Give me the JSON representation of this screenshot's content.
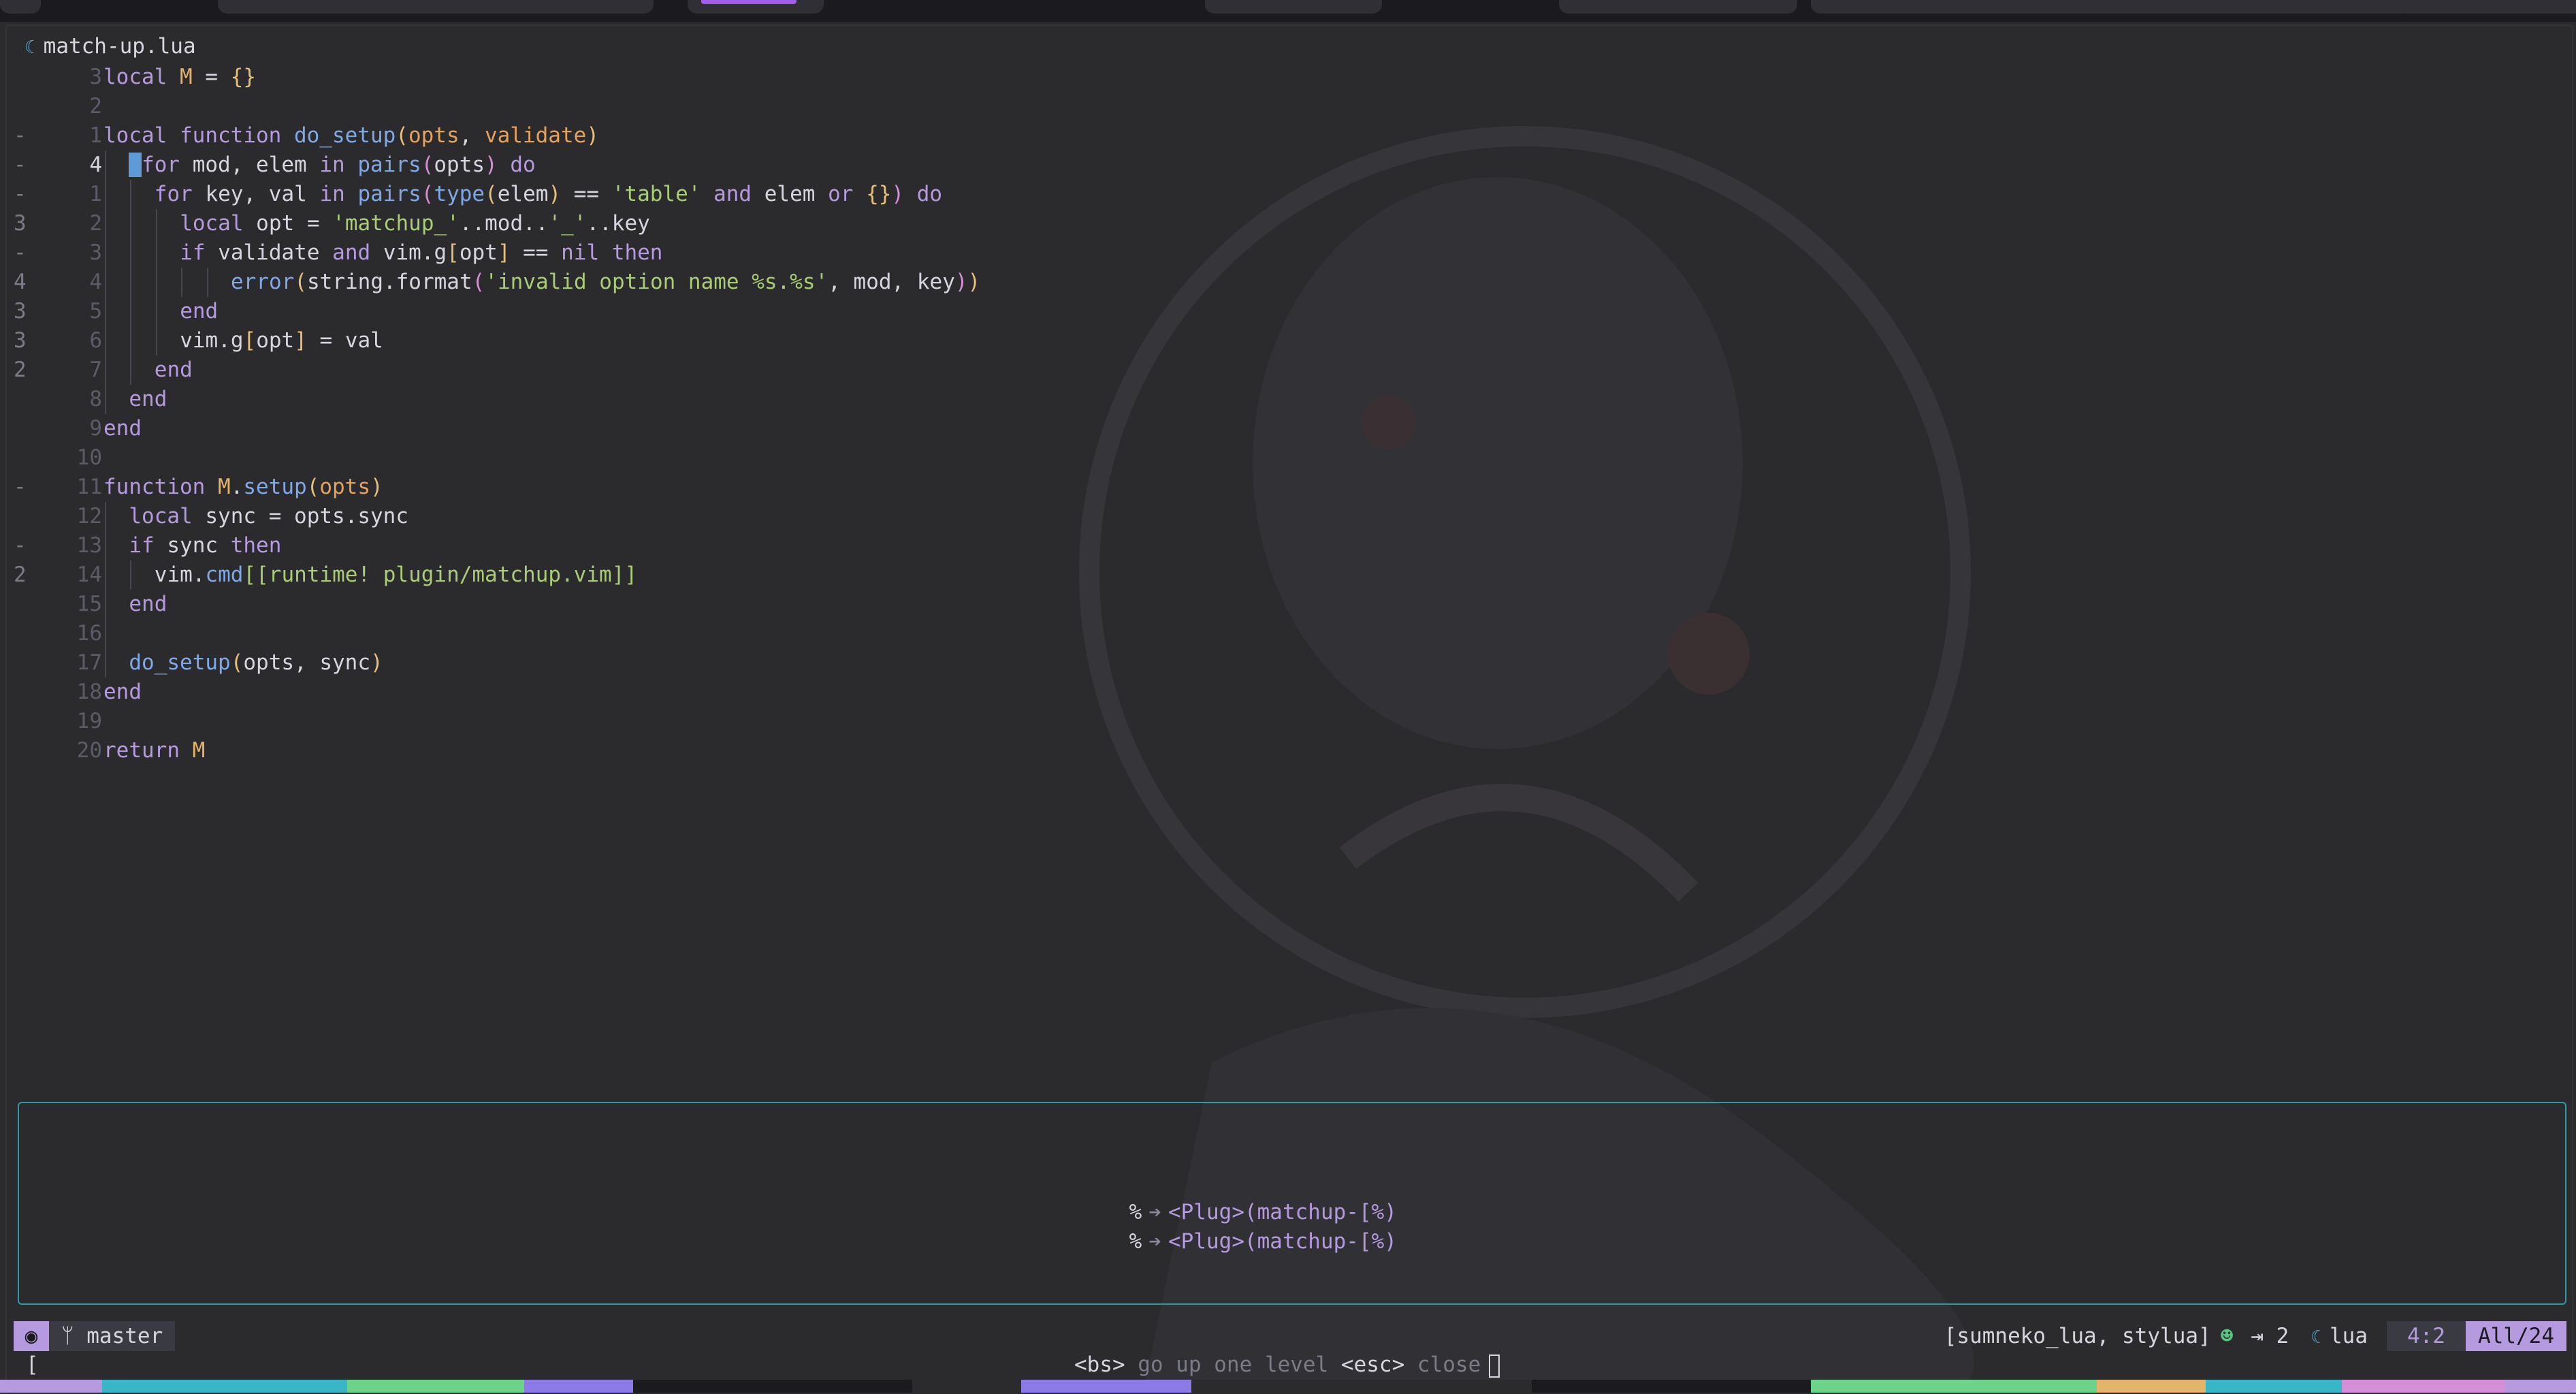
{
  "file_tab": {
    "name": "match-up.lua"
  },
  "code_lines": [
    {
      "rel": "",
      "num": "3",
      "cur": false,
      "indent": 0,
      "tokens": [
        [
          "kw",
          "local"
        ],
        [
          "op",
          " "
        ],
        [
          "var",
          "M"
        ],
        [
          "op",
          " = "
        ],
        [
          "br",
          "{}"
        ]
      ]
    },
    {
      "rel": "",
      "num": "2",
      "cur": false,
      "indent": 0,
      "tokens": []
    },
    {
      "rel": "-",
      "num": "1",
      "cur": false,
      "indent": 0,
      "tokens": [
        [
          "kw",
          "local"
        ],
        [
          "op",
          " "
        ],
        [
          "kw",
          "function"
        ],
        [
          "op",
          " "
        ],
        [
          "fn",
          "do_setup"
        ],
        [
          "br",
          "("
        ],
        [
          "pa",
          "opts"
        ],
        [
          "op",
          ", "
        ],
        [
          "pa",
          "validate"
        ],
        [
          "br",
          ")"
        ]
      ]
    },
    {
      "rel": "-",
      "num": "4",
      "cur": true,
      "indent": 1,
      "tokens": [
        [
          "cursor",
          " "
        ],
        [
          "kw",
          "for"
        ],
        [
          "op",
          " mod, elem "
        ],
        [
          "kw",
          "in"
        ],
        [
          "op",
          " "
        ],
        [
          "fn",
          "pairs"
        ],
        [
          "br2",
          "("
        ],
        [
          "id",
          "opts"
        ],
        [
          "br2",
          ")"
        ],
        [
          "op",
          " "
        ],
        [
          "kw",
          "do"
        ]
      ]
    },
    {
      "rel": "-",
      "num": "1",
      "cur": false,
      "indent": 2,
      "tokens": [
        [
          "kw",
          "for"
        ],
        [
          "op",
          " key, val "
        ],
        [
          "kw",
          "in"
        ],
        [
          "op",
          " "
        ],
        [
          "fn",
          "pairs"
        ],
        [
          "br2",
          "("
        ],
        [
          "fn",
          "type"
        ],
        [
          "br",
          "("
        ],
        [
          "id",
          "elem"
        ],
        [
          "br",
          ")"
        ],
        [
          "op",
          " == "
        ],
        [
          "str",
          "'table'"
        ],
        [
          "op",
          " "
        ],
        [
          "kw",
          "and"
        ],
        [
          "op",
          " elem "
        ],
        [
          "kw",
          "or"
        ],
        [
          "op",
          " "
        ],
        [
          "br",
          "{}"
        ],
        [
          "br2",
          ")"
        ],
        [
          "op",
          " "
        ],
        [
          "kw",
          "do"
        ]
      ]
    },
    {
      "rel": "3",
      "num": "2",
      "cur": false,
      "indent": 3,
      "tokens": [
        [
          "kw",
          "local"
        ],
        [
          "op",
          " opt = "
        ],
        [
          "str",
          "'matchup_'"
        ],
        [
          "op",
          "..mod.."
        ],
        [
          "str",
          "'_'"
        ],
        [
          "op",
          "..key"
        ]
      ]
    },
    {
      "rel": "-",
      "num": "3",
      "cur": false,
      "indent": 3,
      "tokens": [
        [
          "kw",
          "if"
        ],
        [
          "op",
          " validate "
        ],
        [
          "kw",
          "and"
        ],
        [
          "op",
          " vim.g"
        ],
        [
          "br",
          "["
        ],
        [
          "id",
          "opt"
        ],
        [
          "br",
          "]"
        ],
        [
          "op",
          " == "
        ],
        [
          "kw",
          "nil"
        ],
        [
          "op",
          " "
        ],
        [
          "kw",
          "then"
        ]
      ]
    },
    {
      "rel": "4",
      "num": "4",
      "cur": false,
      "indent": 5,
      "tokens": [
        [
          "fn",
          "error"
        ],
        [
          "br",
          "("
        ],
        [
          "id",
          "string.format"
        ],
        [
          "br2",
          "("
        ],
        [
          "str",
          "'invalid option name %s.%s'"
        ],
        [
          "op",
          ", mod, key"
        ],
        [
          "br2",
          ")"
        ],
        [
          "br",
          ")"
        ]
      ]
    },
    {
      "rel": "3",
      "num": "5",
      "cur": false,
      "indent": 3,
      "tokens": [
        [
          "kw",
          "end"
        ]
      ]
    },
    {
      "rel": "3",
      "num": "6",
      "cur": false,
      "indent": 3,
      "tokens": [
        [
          "id",
          "vim.g"
        ],
        [
          "br",
          "["
        ],
        [
          "id",
          "opt"
        ],
        [
          "br",
          "]"
        ],
        [
          "op",
          " = val"
        ]
      ]
    },
    {
      "rel": "2",
      "num": "7",
      "cur": false,
      "indent": 2,
      "tokens": [
        [
          "kw",
          "end"
        ]
      ]
    },
    {
      "rel": "",
      "num": "8",
      "cur": false,
      "indent": 1,
      "tokens": [
        [
          "kw",
          "end"
        ]
      ]
    },
    {
      "rel": "",
      "num": "9",
      "cur": false,
      "indent": 0,
      "tokens": [
        [
          "kw",
          "end"
        ]
      ]
    },
    {
      "rel": "",
      "num": "10",
      "cur": false,
      "indent": 0,
      "tokens": []
    },
    {
      "rel": "-",
      "num": "11",
      "cur": false,
      "indent": 0,
      "tokens": [
        [
          "kw",
          "function"
        ],
        [
          "op",
          " "
        ],
        [
          "var",
          "M"
        ],
        [
          "op",
          "."
        ],
        [
          "fn",
          "setup"
        ],
        [
          "br",
          "("
        ],
        [
          "pa",
          "opts"
        ],
        [
          "br",
          ")"
        ]
      ]
    },
    {
      "rel": "",
      "num": "12",
      "cur": false,
      "indent": 1,
      "tokens": [
        [
          "kw",
          "local"
        ],
        [
          "op",
          " sync = opts.sync"
        ]
      ]
    },
    {
      "rel": "-",
      "num": "13",
      "cur": false,
      "indent": 1,
      "tokens": [
        [
          "kw",
          "if"
        ],
        [
          "op",
          " sync "
        ],
        [
          "kw",
          "then"
        ]
      ]
    },
    {
      "rel": "2",
      "num": "14",
      "cur": false,
      "indent": 2,
      "tokens": [
        [
          "id",
          "vim."
        ],
        [
          "fn",
          "cmd"
        ],
        [
          "str",
          "[[runtime! plugin/matchup.vim]]"
        ]
      ]
    },
    {
      "rel": "",
      "num": "15",
      "cur": false,
      "indent": 1,
      "tokens": [
        [
          "kw",
          "end"
        ]
      ]
    },
    {
      "rel": "",
      "num": "16",
      "cur": false,
      "indent": 1,
      "tokens": []
    },
    {
      "rel": "",
      "num": "17",
      "cur": false,
      "indent": 1,
      "tokens": [
        [
          "fn",
          "do_setup"
        ],
        [
          "br",
          "("
        ],
        [
          "id",
          "opts, sync"
        ],
        [
          "br",
          ")"
        ]
      ]
    },
    {
      "rel": "",
      "num": "18",
      "cur": false,
      "indent": 0,
      "tokens": [
        [
          "kw",
          "end"
        ]
      ]
    },
    {
      "rel": "",
      "num": "19",
      "cur": false,
      "indent": 0,
      "tokens": []
    },
    {
      "rel": "",
      "num": "20",
      "cur": false,
      "indent": 0,
      "tokens": [
        [
          "kw",
          "return"
        ],
        [
          "op",
          " "
        ],
        [
          "var",
          "M"
        ]
      ]
    }
  ],
  "which_key": {
    "items": [
      {
        "key": "%",
        "desc": "<Plug>(matchup-[%)"
      },
      {
        "key": "%",
        "desc": "<Plug>(matchup-[%)"
      }
    ]
  },
  "statusline": {
    "branch": "ᛘ master",
    "lsp": "[sumneko_lua, stylua]",
    "indent": "⇥ 2",
    "filetype": "lua",
    "position": "4:2",
    "scroll": "All/24"
  },
  "cmdline": {
    "bracket": "[",
    "hint": [
      {
        "k": "<bs>",
        "t": " go up one level "
      },
      {
        "k": "<esc>",
        "t": " close"
      }
    ]
  },
  "colors": {
    "accent": "#b69ae0",
    "popup_border": "#2f9aa6",
    "copilot": "#58c47e"
  }
}
